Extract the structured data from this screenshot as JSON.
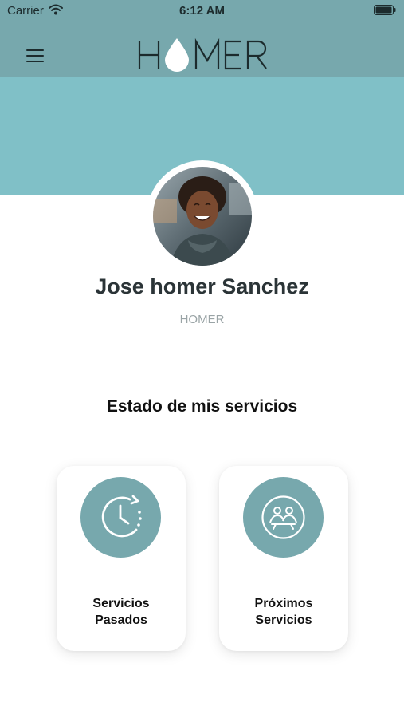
{
  "status_bar": {
    "carrier": "Carrier",
    "time": "6:12 AM"
  },
  "header": {
    "logo_text": "HOMER",
    "menu_icon": "hamburger-menu-icon"
  },
  "profile": {
    "name": "Jose homer Sanchez",
    "role": "HOMER"
  },
  "services": {
    "title": "Estado de mis servicios",
    "cards": [
      {
        "label_line1": "Servicios",
        "label_line2": "Pasados",
        "icon": "history-clock-icon"
      },
      {
        "label_line1": "Próximos",
        "label_line2": "Servicios",
        "icon": "people-meeting-icon"
      }
    ]
  },
  "colors": {
    "header": "#77a8ad",
    "banner": "#80c0c7",
    "accent": "#77a8ad",
    "text_dark": "#2b3437",
    "text_muted": "#9aa4a6"
  }
}
